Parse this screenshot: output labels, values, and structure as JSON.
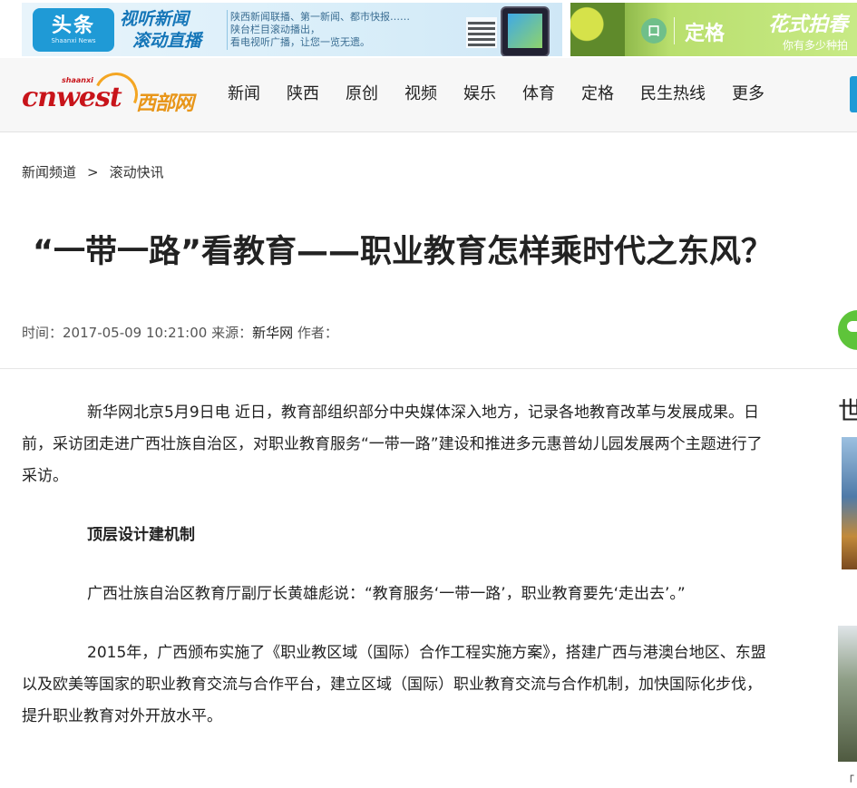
{
  "ads": {
    "left": {
      "logo_main": "头条",
      "logo_sub": "Shaanxi News",
      "slogan_line1": "视听新闻",
      "slogan_line2": "滚动直播",
      "text_line1": "陕西新闻联播、第一新闻、都市快报……",
      "text_line2": "陕台栏目滚动播出，",
      "text_line3": "看电视听广播，让您一览无遗。"
    },
    "right": {
      "icon_glyph": "口",
      "brand": "定格",
      "slogan": "花式拍春",
      "sub": "你有多少种拍"
    }
  },
  "nav": {
    "logo": {
      "latin": "cnwest",
      "sup": "shaanxi",
      "chinese": "西部网"
    },
    "items": [
      "新闻",
      "陕西",
      "原创",
      "视频",
      "娱乐",
      "体育",
      "定格",
      "民生热线",
      "更多"
    ]
  },
  "breadcrumb": {
    "items": [
      "新闻频道",
      "滚动快讯"
    ],
    "separator": ">"
  },
  "article": {
    "title": "“一带一路”看教育——职业教育怎样乘时代之东风？",
    "meta": {
      "time_label": "时间：",
      "time": "2017-05-09 10:21:00",
      "source_label": "来源：",
      "source": "新华网",
      "author_label": "作者："
    },
    "paragraphs": [
      "新华网北京5月9日电 近日，教育部组织部分中央媒体深入地方，记录各地教育改革与发展成果。日前，采访团走进广西壮族自治区，对职业教育服务“一带一路”建设和推进多元惠普幼儿园发展两个主题进行了采访。",
      "顶层设计建机制",
      "广西壮族自治区教育厅副厅长黄雄彪说：“教育服务‘一带一路’，职业教育要先‘走出去’。”",
      "2015年，广西颁布实施了《职业教区域（国际）合作工程实施方案》，搭建广西与港澳台地区、东盟以及欧美等国家的职业教育交流与合作平台，建立区域（国际）职业教育交流与合作机制，加快国际化步伐，提升职业教育对外开放水平。"
    ]
  },
  "side": {
    "heading": "世",
    "caption": "「"
  },
  "colors": {
    "nav_accent": "#1f9ad6",
    "logo_red": "#c8141a",
    "logo_orange": "#e8961a",
    "share_green": "#5ec43a"
  },
  "icons": [
    "wechat-share-icon"
  ]
}
